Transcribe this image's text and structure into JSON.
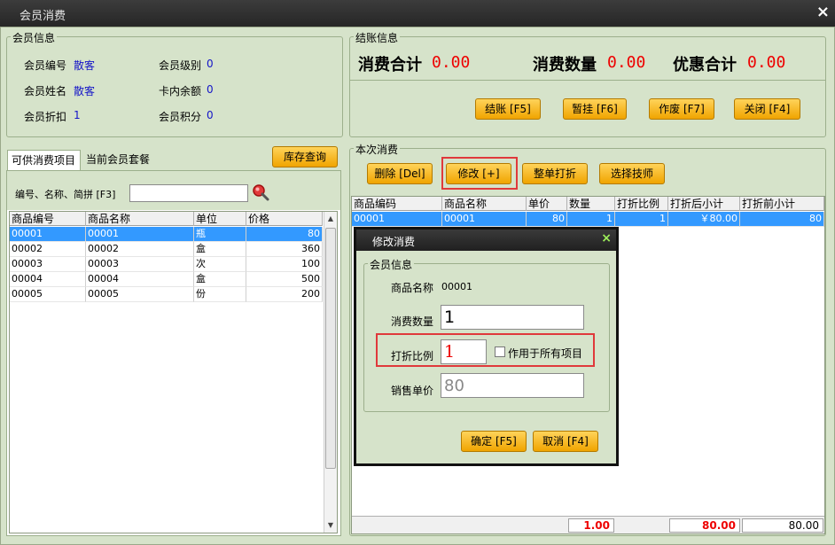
{
  "window": {
    "title": "会员消费",
    "close": "×"
  },
  "member": {
    "legend": "会员信息",
    "id_label": "会员编号",
    "id_value": "散客",
    "level_label": "会员级别",
    "level_value": "0",
    "name_label": "会员姓名",
    "name_value": "散客",
    "balance_label": "卡内余额",
    "balance_value": "0",
    "discount_label": "会员折扣",
    "discount_value": "1",
    "points_label": "会员积分",
    "points_value": "0"
  },
  "checkout": {
    "legend": "结账信息",
    "total_label": "消费合计",
    "total_value": "0.00",
    "qty_label": "消费数量",
    "qty_value": "0.00",
    "disc_label": "优惠合计",
    "disc_value": "0.00",
    "btn_checkout": "结账 [F5]",
    "btn_hold": "暂挂 [F6]",
    "btn_void": "作废 [F7]",
    "btn_close": "关闭 [F4]"
  },
  "left": {
    "tab_items": "可供消费项目",
    "tab_packages": "当前会员套餐",
    "btn_stock": "库存查询",
    "search_label": "编号、名称、简拼 [F3]",
    "search_value": "",
    "columns": [
      "商品编号",
      "商品名称",
      "单位",
      "价格"
    ],
    "rows": [
      [
        "00001",
        "00001",
        "瓶",
        "80"
      ],
      [
        "00002",
        "00002",
        "盒",
        "360"
      ],
      [
        "00003",
        "00003",
        "次",
        "100"
      ],
      [
        "00004",
        "00004",
        "盒",
        "500"
      ],
      [
        "00005",
        "00005",
        "份",
        "200"
      ]
    ]
  },
  "current": {
    "legend": "本次消费",
    "btn_delete": "删除 [Del]",
    "btn_modify": "修改 [+]",
    "btn_whole_discount": "整单打折",
    "btn_technician": "选择技师",
    "columns": [
      "商品编码",
      "商品名称",
      "单价",
      "数量",
      "打折比例",
      "打折后小计",
      "打折前小计"
    ],
    "rows": [
      [
        "00001",
        "00001",
        "80",
        "1",
        "1",
        "￥80.00",
        "80"
      ]
    ],
    "foot_qty": "1.00",
    "foot_after": "80.00",
    "foot_before": "80.00"
  },
  "dialog": {
    "title": "修改消费",
    "close": "×",
    "legend": "会员信息",
    "product_label": "商品名称",
    "product_value": "00001",
    "qty_label": "消费数量",
    "qty_value": "1",
    "ratio_label": "打折比例",
    "ratio_value": "1",
    "apply_all_label": "作用于所有项目",
    "price_label": "销售单价",
    "price_value": "80",
    "btn_ok": "确定 [F5]",
    "btn_cancel": "取消 [F4]"
  },
  "colors": {
    "accent": "#f0a400",
    "highlight": "#e0393b",
    "selection": "#3399ff"
  }
}
